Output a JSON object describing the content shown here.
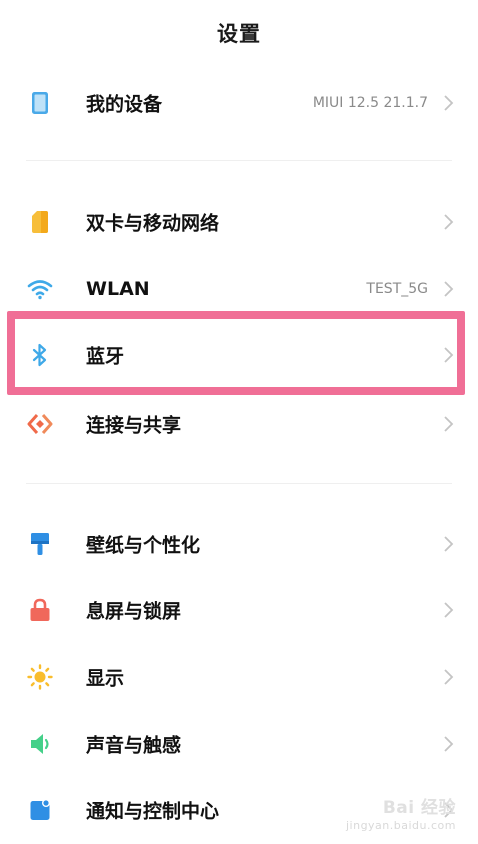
{
  "header": {
    "title": "设置"
  },
  "rows": {
    "device": {
      "label": "我的设备",
      "value": "MIUI 12.5 21.1.7"
    },
    "sim": {
      "label": "双卡与移动网络"
    },
    "wlan": {
      "label": "WLAN",
      "value": "TEST_5G"
    },
    "bluetooth": {
      "label": "蓝牙"
    },
    "connection": {
      "label": "连接与共享"
    },
    "wallpaper": {
      "label": "壁纸与个性化"
    },
    "lockscreen": {
      "label": "息屏与锁屏"
    },
    "display": {
      "label": "显示"
    },
    "sound": {
      "label": "声音与触感"
    },
    "notification": {
      "label": "通知与控制中心"
    }
  },
  "watermark": {
    "text": "Bai 经验",
    "sub": "jingyan.baidu.com"
  },
  "colors": {
    "highlight": "#f06f96",
    "device_icon": "#4aa9e8",
    "sim_icon": "#f7be3a",
    "wifi_icon": "#3fa9e8",
    "bluetooth_icon": "#3fa9e8",
    "connection_icon": "#f06a4a",
    "wallpaper_icon": "#2f8fe4",
    "lock_icon": "#f0685b",
    "display_icon": "#f9bd2c",
    "sound_icon": "#44d089",
    "notification_icon": "#2f8fe4"
  },
  "icons": [
    "device-icon",
    "sim-card-icon",
    "wifi-icon",
    "bluetooth-icon",
    "share-icon",
    "paintbrush-icon",
    "lock-icon",
    "sun-icon",
    "speaker-icon",
    "notification-icon",
    "chevron-right-icon"
  ]
}
